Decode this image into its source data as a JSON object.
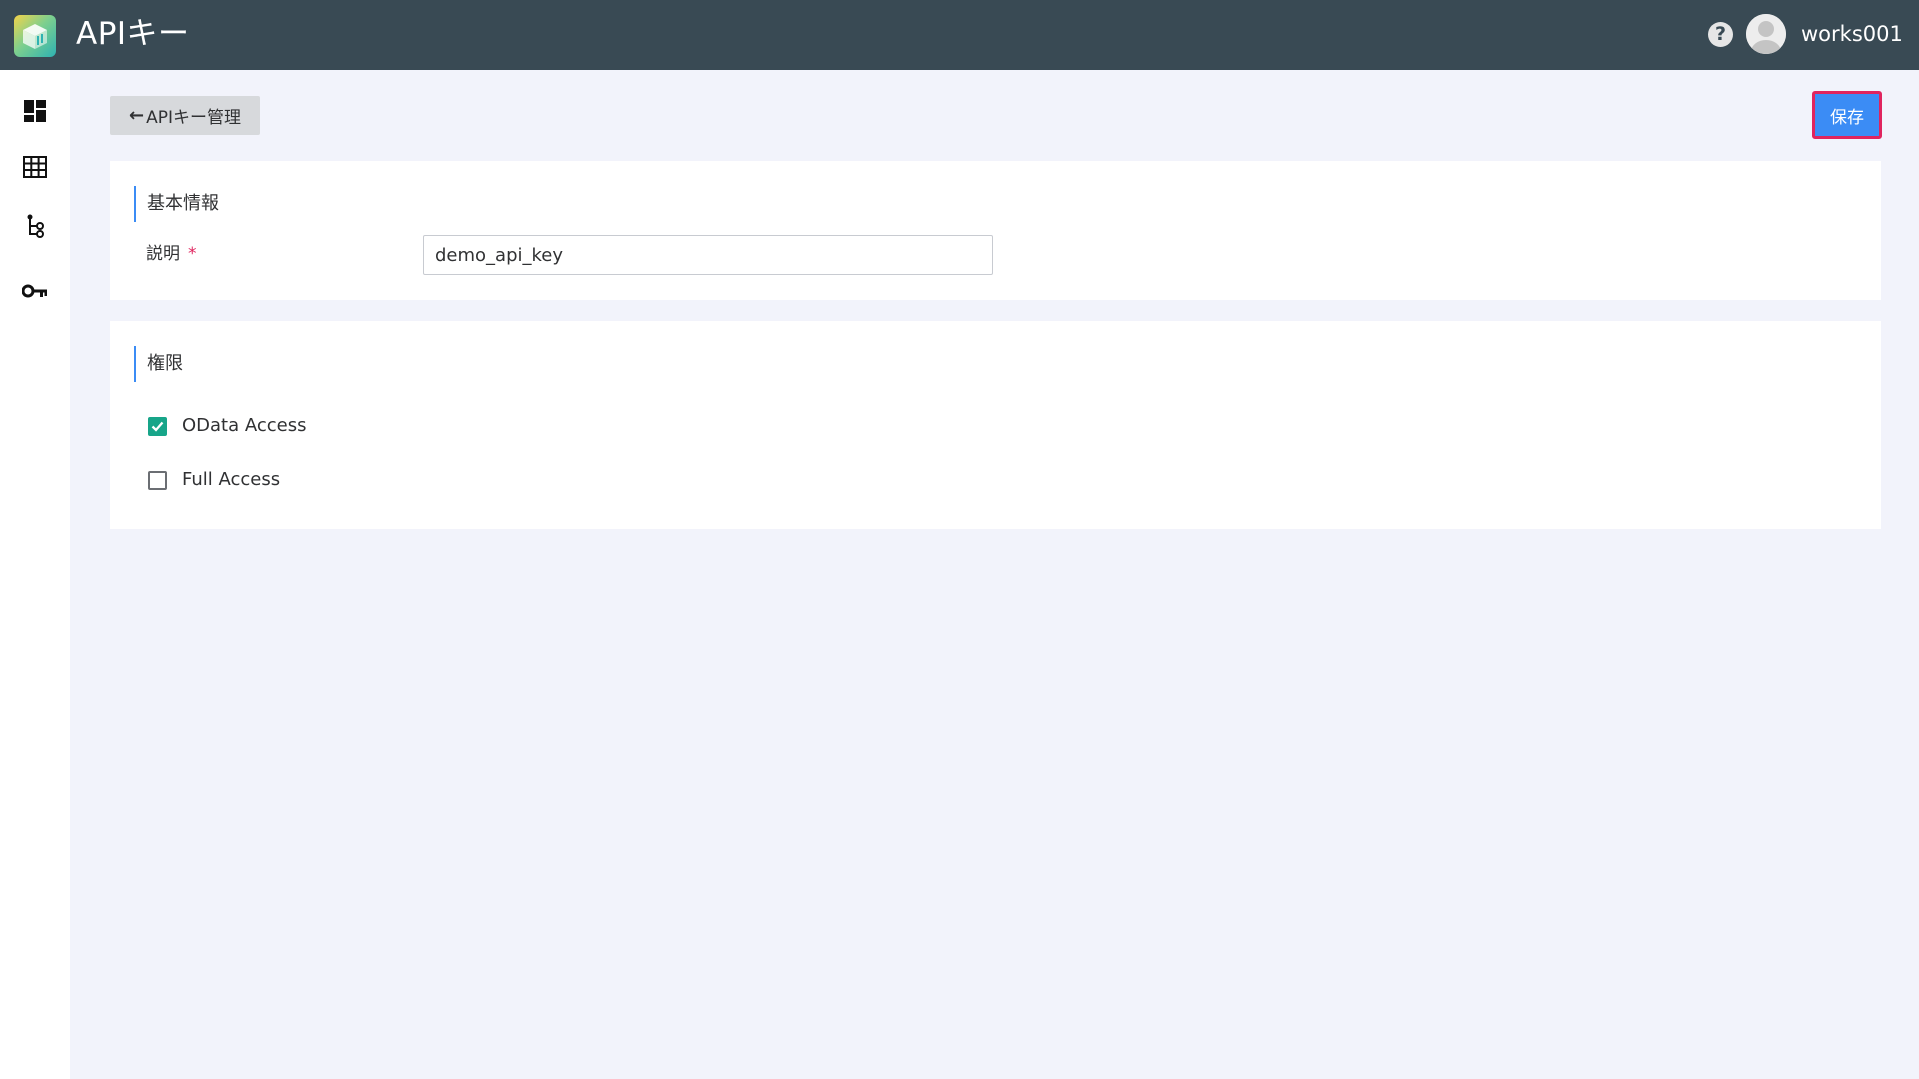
{
  "header": {
    "app_title": "APIキー",
    "help_glyph": "?",
    "username": "works001"
  },
  "sidebar": {
    "items": [
      {
        "icon": "dashboard-icon"
      },
      {
        "icon": "table-grid-icon"
      },
      {
        "icon": "tree-structure-icon"
      },
      {
        "icon": "key-icon"
      }
    ]
  },
  "toolbar": {
    "back_label": "APIキー管理",
    "save_label": "保存"
  },
  "basic_info": {
    "title": "基本情報",
    "description_label": "説明",
    "required_mark": "*",
    "description_value": "demo_api_key"
  },
  "permissions": {
    "title": "権限",
    "options": [
      {
        "label": "OData Access",
        "checked": true
      },
      {
        "label": "Full Access",
        "checked": false
      }
    ]
  },
  "colors": {
    "header_bg": "#394a54",
    "accent": "#3b8cf5",
    "checkbox_checked": "#17a589",
    "required": "#e0245e"
  }
}
